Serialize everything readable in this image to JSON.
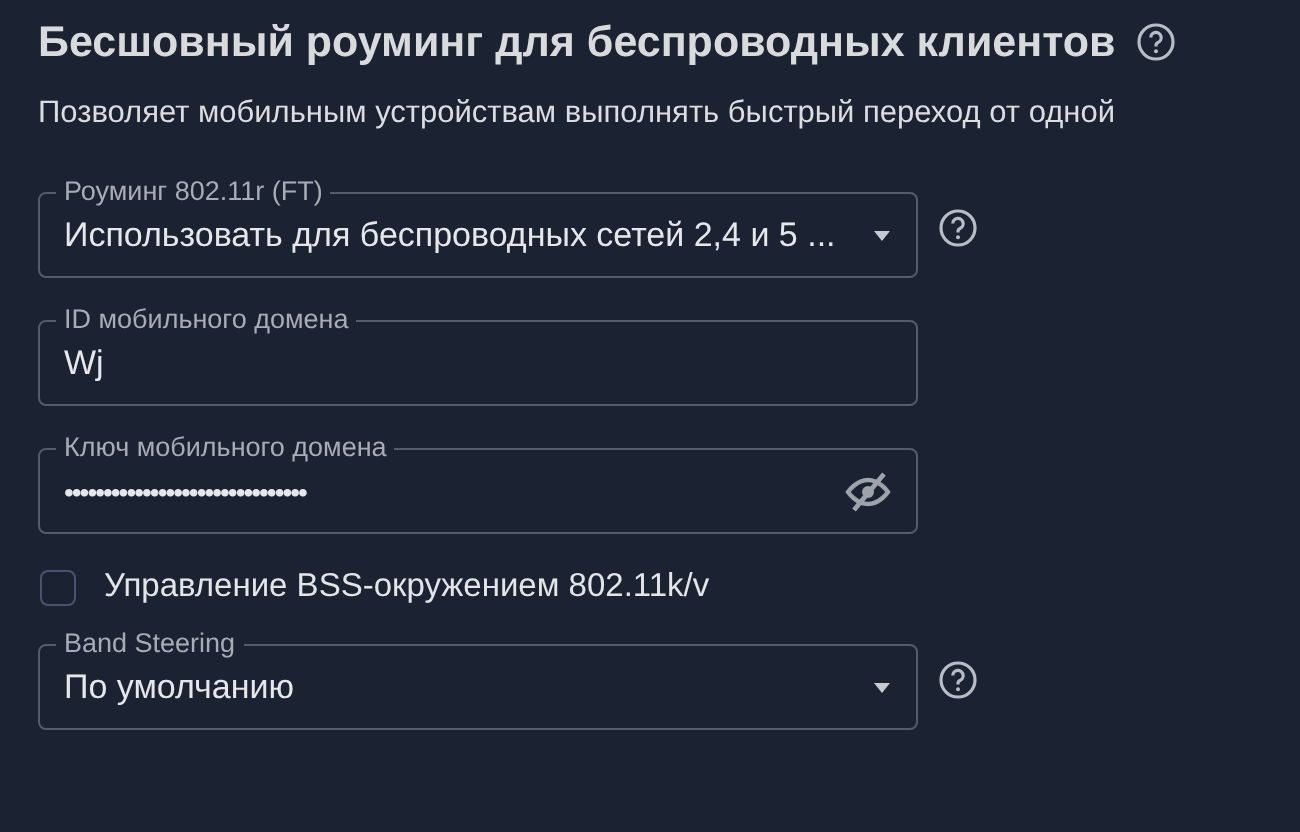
{
  "section": {
    "title": "Бесшовный роуминг для беспроводных клиентов",
    "description": "Позволяет мобильным устройствам выполнять быстрый переход от одной"
  },
  "fields": [
    {
      "kind": "select",
      "label": "Роуминг 802.11r (FT)",
      "value": "Использовать для беспроводных сетей 2,4 и 5 ...",
      "help": true
    },
    {
      "kind": "text",
      "label": "ID мобильного домена",
      "value": "Wj",
      "help": false
    },
    {
      "kind": "password",
      "label": "Ключ мобильного домена",
      "value": "•••••••••••••••••••••••••••••••",
      "help": false
    },
    {
      "kind": "checkbox",
      "label": "Управление BSS-окружением 802.11k/v",
      "checked": false
    },
    {
      "kind": "select",
      "label": "Band Steering",
      "value": "По умолчанию",
      "help": true
    }
  ]
}
